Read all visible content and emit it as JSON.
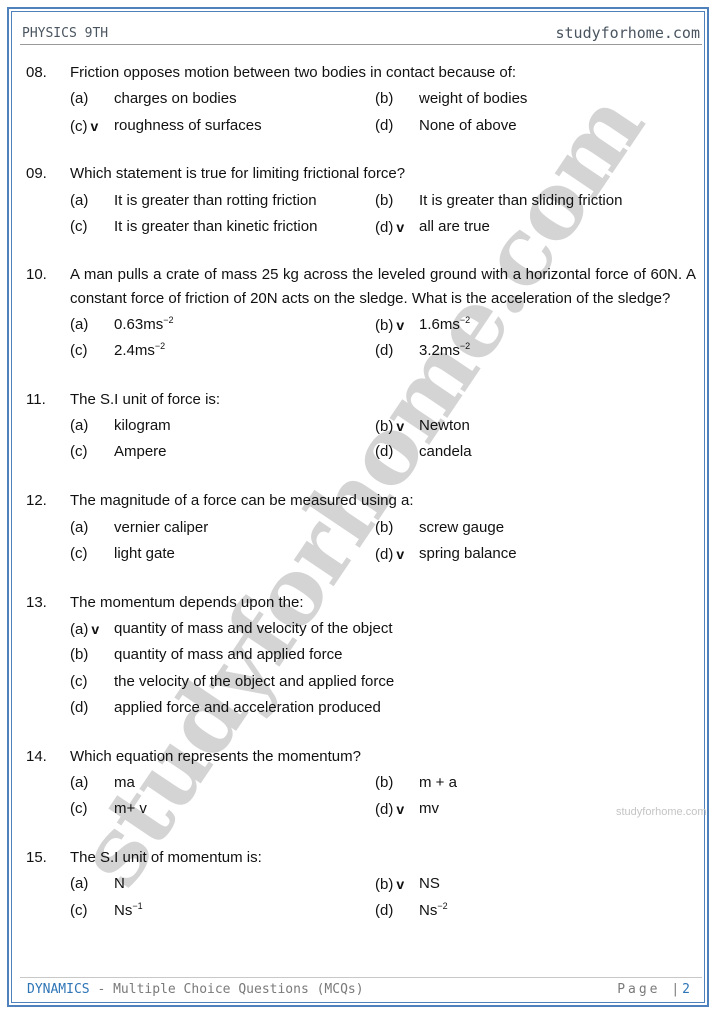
{
  "header": {
    "subject": "PHYSICS 9TH",
    "site": "studyforhome.com"
  },
  "footer": {
    "chapter": "DYNAMICS",
    "separator": " - ",
    "section": "Multiple Choice Questions (MCQs)",
    "page_label": "Page |",
    "page_number": "2"
  },
  "watermark": {
    "large_text": "studyforhome.com",
    "small_text": "studyforhome.com"
  },
  "check_mark": "v",
  "questions": [
    {
      "number": "08.",
      "text": "Friction opposes motion between two bodies in contact because of:",
      "layout": "two-column",
      "options": [
        {
          "label": "(a)",
          "text": "charges on bodies",
          "correct": false
        },
        {
          "label": "(b)",
          "text": "weight of bodies",
          "correct": false
        },
        {
          "label": "(c)",
          "text": "roughness of surfaces",
          "correct": true
        },
        {
          "label": "(d)",
          "text": "None of above",
          "correct": false
        }
      ]
    },
    {
      "number": "09.",
      "text": "Which statement is true for limiting frictional force?",
      "layout": "two-column",
      "options": [
        {
          "label": "(a)",
          "text": "It is greater than rotting friction",
          "correct": false
        },
        {
          "label": "(b)",
          "text": "It is greater than sliding friction",
          "correct": false
        },
        {
          "label": "(c)",
          "text": "It is greater than kinetic friction",
          "correct": false
        },
        {
          "label": "(d)",
          "text": "all are true",
          "correct": true
        }
      ]
    },
    {
      "number": "10.",
      "text": "A man pulls a crate of mass 25 kg across the leveled ground with a horizontal force of 60N. A constant force of friction of 20N acts on the sledge. What is the acceleration of the sledge?",
      "layout": "two-column",
      "options": [
        {
          "label": "(a)",
          "text": "0.63ms",
          "sup": "−2",
          "correct": false
        },
        {
          "label": "(b)",
          "text": "1.6ms",
          "sup": "−2",
          "correct": true
        },
        {
          "label": "(c)",
          "text": "2.4ms",
          "sup": "−2",
          "correct": false
        },
        {
          "label": "(d)",
          "text": "3.2ms",
          "sup": "−2",
          "correct": false
        }
      ]
    },
    {
      "number": "11.",
      "text": "The S.I unit of force is:",
      "layout": "two-column",
      "options": [
        {
          "label": "(a)",
          "text": "kilogram",
          "correct": false
        },
        {
          "label": "(b)",
          "text": "Newton",
          "correct": true
        },
        {
          "label": "(c)",
          "text": "Ampere",
          "correct": false
        },
        {
          "label": "(d)",
          "text": "candela",
          "correct": false
        }
      ]
    },
    {
      "number": "12.",
      "text": "The magnitude of a force can be measured using a:",
      "layout": "two-column",
      "options": [
        {
          "label": "(a)",
          "text": "vernier caliper",
          "correct": false
        },
        {
          "label": "(b)",
          "text": "screw gauge",
          "correct": false
        },
        {
          "label": "(c)",
          "text": "light gate",
          "correct": false
        },
        {
          "label": "(d)",
          "text": "spring balance",
          "correct": true
        }
      ]
    },
    {
      "number": "13.",
      "text": "The momentum depends upon the:",
      "layout": "single-column",
      "options": [
        {
          "label": "(a)",
          "text": "quantity of mass and velocity of the object",
          "correct": true
        },
        {
          "label": "(b)",
          "text": "quantity of mass and applied force",
          "correct": false
        },
        {
          "label": "(c)",
          "text": "the velocity of the object and applied force",
          "correct": false
        },
        {
          "label": "(d)",
          "text": "applied force and acceleration produced",
          "correct": false
        }
      ]
    },
    {
      "number": "14.",
      "text": "Which equation represents the momentum?",
      "layout": "two-column",
      "options": [
        {
          "label": "(a)",
          "text": "ma",
          "correct": false
        },
        {
          "label": "(b)",
          "text": "m + a",
          "correct": false
        },
        {
          "label": "(c)",
          "text": "m+ v",
          "correct": false
        },
        {
          "label": "(d)",
          "text": "mv",
          "correct": true
        }
      ]
    },
    {
      "number": "15.",
      "text": "The S.I unit of momentum is:",
      "layout": "two-column",
      "options": [
        {
          "label": "(a)",
          "text": "N",
          "correct": false
        },
        {
          "label": "(b)",
          "text": "NS",
          "correct": true
        },
        {
          "label": "(c)",
          "text": "Ns",
          "sup": "−1",
          "correct": false
        },
        {
          "label": "(d)",
          "text": "Ns",
          "sup": "−2",
          "correct": false
        }
      ]
    }
  ]
}
